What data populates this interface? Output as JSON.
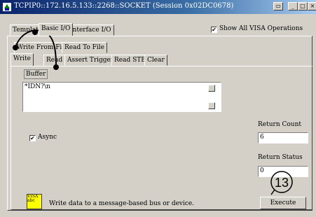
{
  "window": {
    "title": "TCPIP0::172.16.5.133::2268::SOCKET (Session 0x02DC0678)"
  },
  "tabs_top": [
    "Template",
    "Basic I/O",
    "Interface I/O"
  ],
  "show_all_label": "Show All VISA Operations",
  "show_all_checked": true,
  "tabs_sub": [
    "Write From File",
    "Read To File"
  ],
  "tabs_ops": [
    "Write",
    "Read",
    "Assert Trigger",
    "Read STB",
    "Clear"
  ],
  "buffer": {
    "label": "Buffer",
    "value": "*IDN?\\n"
  },
  "async": {
    "label": "Async",
    "checked": true
  },
  "return_count": {
    "label": "Return Count",
    "value": "6"
  },
  "return_status": {
    "label": "Return Status",
    "value": "0"
  },
  "help_text": "Write data to a message-based bus or device.",
  "execute_label": "Execute",
  "callout_number": "13",
  "visa_icon_text": "VISA abc"
}
